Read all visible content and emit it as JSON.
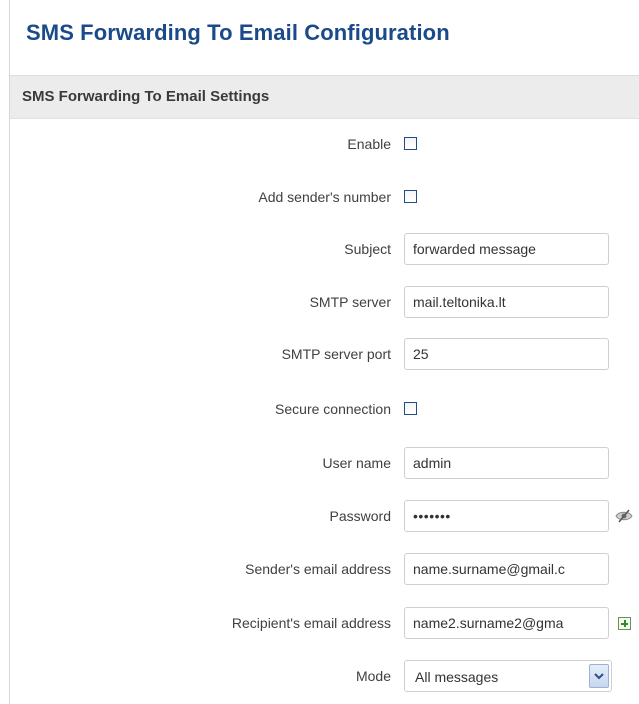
{
  "page": {
    "title": "SMS Forwarding To Email Configuration"
  },
  "section": {
    "title": "SMS Forwarding To Email Settings"
  },
  "fields": {
    "enable": {
      "label": "Enable",
      "checked": false
    },
    "add_sender_number": {
      "label": "Add sender's number",
      "checked": false
    },
    "subject": {
      "label": "Subject",
      "value": "forwarded message"
    },
    "smtp_server": {
      "label": "SMTP server",
      "value": "mail.teltonika.lt"
    },
    "smtp_port": {
      "label": "SMTP server port",
      "value": "25"
    },
    "secure_connection": {
      "label": "Secure connection",
      "checked": false
    },
    "user_name": {
      "label": "User name",
      "value": "admin"
    },
    "password": {
      "label": "Password",
      "value": "•••••••"
    },
    "sender_email": {
      "label": "Sender's email address",
      "value": "name.surname@gmail.c"
    },
    "recipient_email": {
      "label": "Recipient's email address",
      "value": "name2.surname2@gma"
    },
    "mode": {
      "label": "Mode",
      "value": "All messages"
    }
  },
  "icons": {
    "password_toggle": "eye-slash-icon",
    "add_recipient": "plus-icon",
    "dropdown": "chevron-down-icon"
  },
  "colors": {
    "title": "#1b4a8a",
    "header_bg": "#ececec",
    "add_icon": "#2e8b2e"
  }
}
